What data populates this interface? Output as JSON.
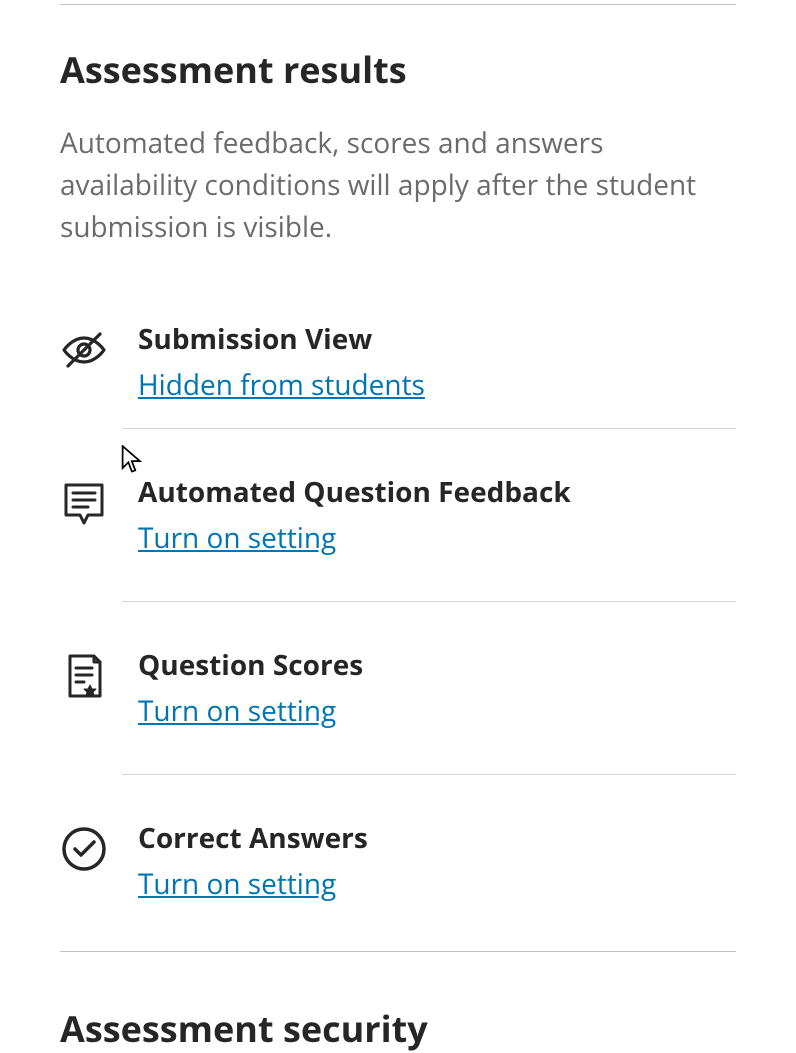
{
  "section1": {
    "title": "Assessment results",
    "description": "Automated feedback, scores and answers availability conditions will apply after the student submission is visible."
  },
  "settings": [
    {
      "title": "Submission View",
      "link": "Hidden from students"
    },
    {
      "title": "Automated Question Feedback",
      "link": "Turn on setting"
    },
    {
      "title": "Question Scores",
      "link": "Turn on setting"
    },
    {
      "title": "Correct Answers",
      "link": "Turn on setting"
    }
  ],
  "section2": {
    "title": "Assessment security"
  },
  "colors": {
    "link": "#0075b4",
    "text": "#262626",
    "muted": "#6b6b6b"
  }
}
